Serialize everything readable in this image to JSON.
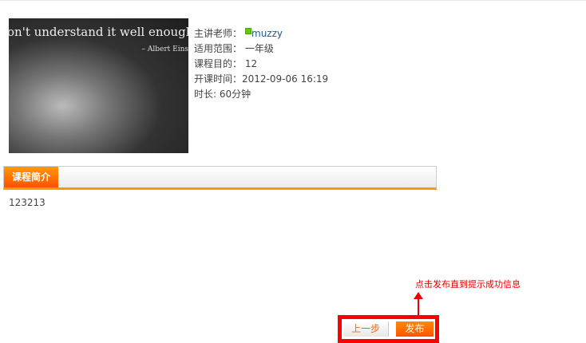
{
  "course_image": {
    "quote_line": "on't understand it well enough",
    "quote_author": "– Albert Eins"
  },
  "info": {
    "teacher_label": "主讲老师：",
    "teacher_name": "muzzy",
    "scope_label": "适用范围：",
    "scope_value": "一年级",
    "goal_label": "课程目的：",
    "goal_value": "12",
    "start_label": "开课时间：",
    "start_value": "2012-09-06 16:19",
    "duration_label": "时长: ",
    "duration_value": "60分钟"
  },
  "tabs": {
    "intro_label": "课程简介"
  },
  "intro_text": "123213",
  "annotation": {
    "text": "点击发布直到提示成功信息",
    "color": "#ff0000"
  },
  "buttons": {
    "prev_label": "上一步",
    "publish_label": "发布"
  },
  "accent_color": "#ff6600"
}
